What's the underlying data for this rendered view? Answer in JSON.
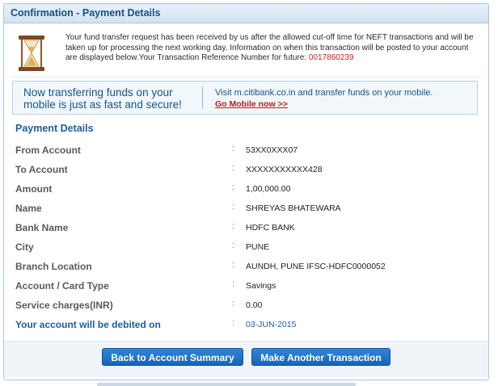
{
  "header": {
    "title": "Confirmation - Payment Details"
  },
  "notice": {
    "icon": "hourglass-icon",
    "text": "Your fund transfer request has been received by us after the allowed cut-off time for NEFT transactions and will be taken up for processing the next working day. Information on when this transaction will be posted to your account are displayed below.Your Transaction Reference Number for future: ",
    "reference_number": "0017860239"
  },
  "banner": {
    "left_line1": "Now transferring funds on your",
    "left_line2": "mobile is just as fast and secure!",
    "right_text": "Visit m.citibank.co.in and transfer funds on your mobile.",
    "link_label": "Go Mobile now >>"
  },
  "payment_details": {
    "title": "Payment Details",
    "separator": ":",
    "rows": [
      {
        "label": "From Account",
        "value": "53XX0XXX07"
      },
      {
        "label": "To Account",
        "value": "XXXXXXXXXXX428"
      },
      {
        "label": "Amount",
        "value": "1,00,000.00"
      },
      {
        "label": "Name",
        "value": "SHREYAS BHATEWARA"
      },
      {
        "label": "Bank Name",
        "value": "HDFC BANK"
      },
      {
        "label": "City",
        "value": "PUNE"
      },
      {
        "label": "Branch Location",
        "value": "AUNDH, PUNE IFSC-HDFC0000052"
      },
      {
        "label": "Account / Card Type",
        "value": "Savings"
      },
      {
        "label": "Service charges(INR)",
        "value": "0.00"
      },
      {
        "label": "Your account will be debited on",
        "value": "03-JUN-2015"
      }
    ]
  },
  "buttons": {
    "summary_label": "Back to Account Summary",
    "another_label": "Make Another Transaction"
  },
  "colors": {
    "accent": "#1a5fa6",
    "reference": "#cc1f1f",
    "button": "#1f73c9"
  }
}
